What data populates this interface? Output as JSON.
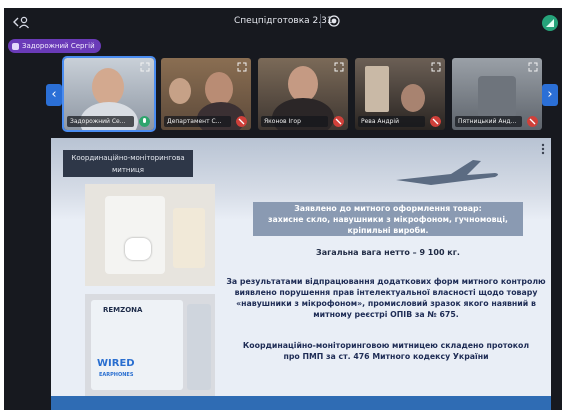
{
  "topbar": {
    "title": "Спецпідготовка 2.31",
    "back_icon": "person-back-icon",
    "rec_icon": "record-icon",
    "signal_icon": "signal-icon"
  },
  "speaker_badge": {
    "label": "Задорожний Сергій"
  },
  "participants": [
    {
      "name": "Задорожний Се...",
      "active": true
    },
    {
      "name": "Департамент С..."
    },
    {
      "name": "Яконов Ігор"
    },
    {
      "name": "Рева Андрій"
    },
    {
      "name": "Пятницький Анд..."
    }
  ],
  "nav": {
    "prev": "‹",
    "next": "›"
  },
  "slide": {
    "header_line1": "Координаційно-моніторингова",
    "header_line2": "митниця",
    "declared_line1": "Заявлено до митного оформлення товар:",
    "declared_line2": "захисне скло, навушники з мікрофоном, гучномовці,",
    "declared_line3": "кріпильні вироби.",
    "weight": "Загальна вага нетто – 9 100 кг.",
    "body_line1": "За результатами відпрацювання додаткових форм митного контролю",
    "body_line2": "виявлено порушення прав інтелектуальної власності щодо товару",
    "body_line3": "«навушники з мікрофоном», промисловий зразок якого наявний в",
    "body_line4": "митному реєстрі ОПІВ за № 675.",
    "protocol_line1": "Координаційно-моніторинговою митницею складено протокол",
    "protocol_line2": "про ПМП за ст. 476 Митного кодексу України",
    "photo2_brand": "REMZONA",
    "photo2_text1": "WIRED",
    "photo2_text2": "EARPHONES"
  },
  "colors": {
    "background": "#17191f",
    "accent": "#2b6fd6",
    "badge": "#6a3bb8",
    "mic_muted": "#d0403a"
  }
}
